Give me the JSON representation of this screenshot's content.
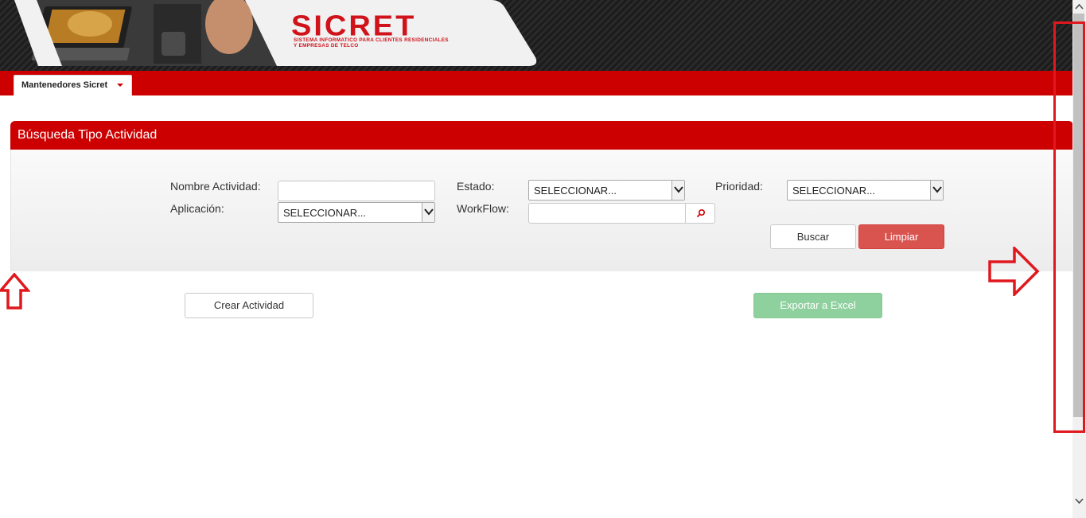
{
  "header": {
    "logo_text": "SICRET",
    "logo_subtitle": "SISTEMA INFORMATICO PARA CLIENTES RESIDENCIALES Y EMPRESAS DE TELCO"
  },
  "nav": {
    "menu_label": "Mantenedores Sicret",
    "menu_icon": "caret-down-icon"
  },
  "panel": {
    "title": "Búsqueda Tipo Actividad",
    "fields": {
      "nombre_actividad": {
        "label": "Nombre Actividad:",
        "value": ""
      },
      "estado": {
        "label": "Estado:",
        "selected": "SELECCIONAR..."
      },
      "prioridad": {
        "label": "Prioridad:",
        "selected": "SELECCIONAR..."
      },
      "aplicacion": {
        "label": "Aplicación:",
        "selected": "SELECCIONAR..."
      },
      "workflow": {
        "label": "WorkFlow:",
        "value": "",
        "button_icon": "search-icon"
      }
    },
    "buttons": {
      "buscar": "Buscar",
      "limpiar": "Limpiar"
    }
  },
  "actions": {
    "crear": "Crear Actividad",
    "exportar": "Exportar a Excel"
  },
  "colors": {
    "brand_red": "#cc0000",
    "danger": "#d9534f",
    "success_disabled": "#8fd19e",
    "annotation": "#e0181e"
  }
}
